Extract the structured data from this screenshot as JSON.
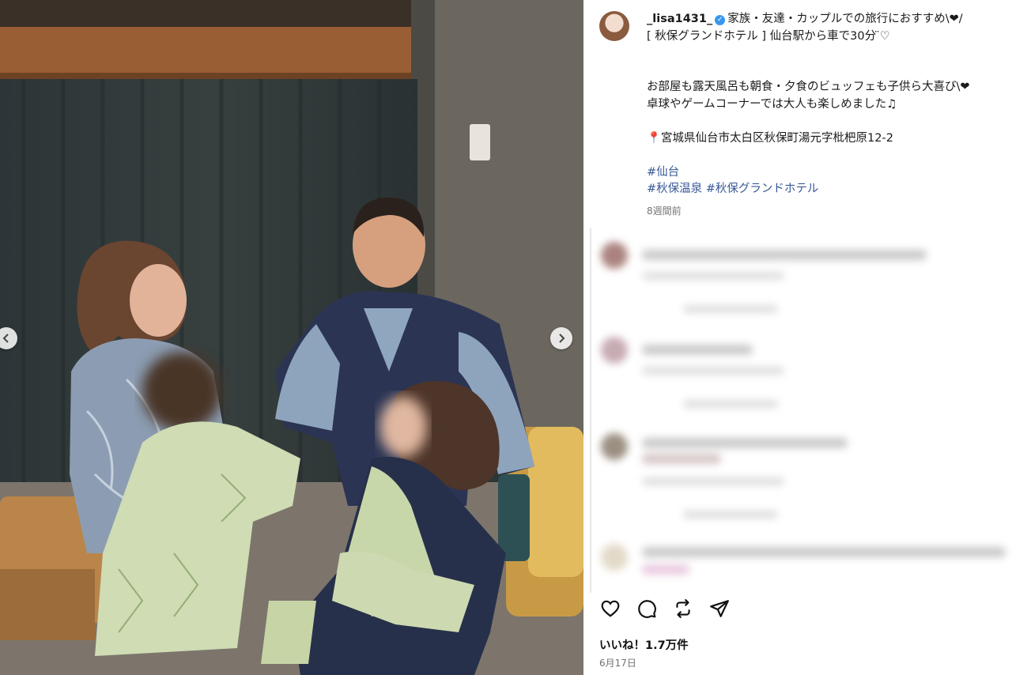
{
  "post": {
    "username": "_lisa1431_",
    "caption_lines": [
      "家族・友達・カップルでの旅行におすすめ\\❤︎/",
      "[ 秋保グランドホテル ] 仙台駅から車で30分 ̈♡",
      "",
      "",
      "お部屋も露天風呂も朝食・夕食のビュッフェも子供ら大喜び\\❤︎",
      "卓球やゲームコーナーでは大人も楽しめました♫",
      "",
      "📍宮城県仙台市太白区秋保町湯元字枇杷原12-2",
      ""
    ],
    "hashtag_line1": "#仙台",
    "hashtag_line2": "#秋保温泉 #秋保グランドホテル",
    "age": "8週間前",
    "likes": "いいね！1.7万件",
    "date": "6月17日"
  },
  "icons": {
    "verified": "verified-badge-icon",
    "like": "heart-icon",
    "comment": "comment-icon",
    "repost": "repost-icon",
    "share": "send-icon",
    "prev": "chevron-left-icon",
    "next": "chevron-right-icon"
  },
  "colors": {
    "verified": "#3897f0",
    "hashtag": "#385898",
    "muted": "#737373"
  }
}
